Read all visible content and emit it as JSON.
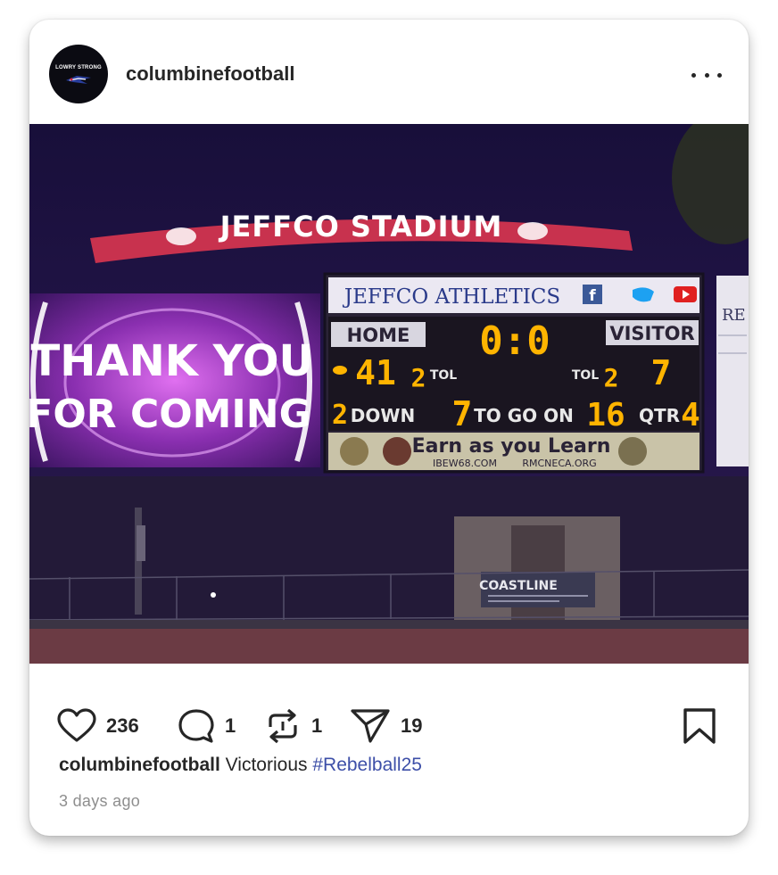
{
  "post": {
    "username": "columbinefootball",
    "avatar_text": "LOWRY STRONG",
    "likes": "236",
    "comments": "1",
    "reposts": "1",
    "shares": "19",
    "caption_user": "columbinefootball",
    "caption_text": "Victorious",
    "caption_tag": "#Rebelball25",
    "time_ago": "3 days ago"
  },
  "photo": {
    "stadium_name": "JEFFCO STADIUM",
    "video_board_line1": "THANK YOU",
    "video_board_line2": "FOR COMING",
    "sponsor_header": "JEFFCO ATHLETICS",
    "home_label": "HOME",
    "visitor_label": "VISITOR",
    "clock": "0:0",
    "home_score": "41",
    "home_tol": "2",
    "tol_label": "TOL",
    "visitor_tol": "2",
    "visitor_score": "7",
    "down": "2",
    "down_label": "DOWN",
    "to_go": "7",
    "to_go_label": "TO GO ON",
    "ball_on": "16",
    "qtr_label": "QTR",
    "qtr": "4",
    "sponsor_slogan": "Earn as you Learn",
    "sponsor_url1": "IBEW68.COM",
    "sponsor_url2": "RMCNECA.ORG",
    "fence_sign": "COASTLINE",
    "side_sign": "RE"
  },
  "icons": {
    "like": "heart-icon",
    "comment": "speech-bubble-icon",
    "repost": "repost-arrows-icon",
    "share": "paper-plane-icon",
    "save": "bookmark-icon",
    "more": "more-dots-icon"
  },
  "colors": {
    "hashtag": "#3d4fa8",
    "scoreboard_digit": "#ffb400",
    "stadium_banner": "#c8324e",
    "video_board": "#7a2f9a"
  }
}
